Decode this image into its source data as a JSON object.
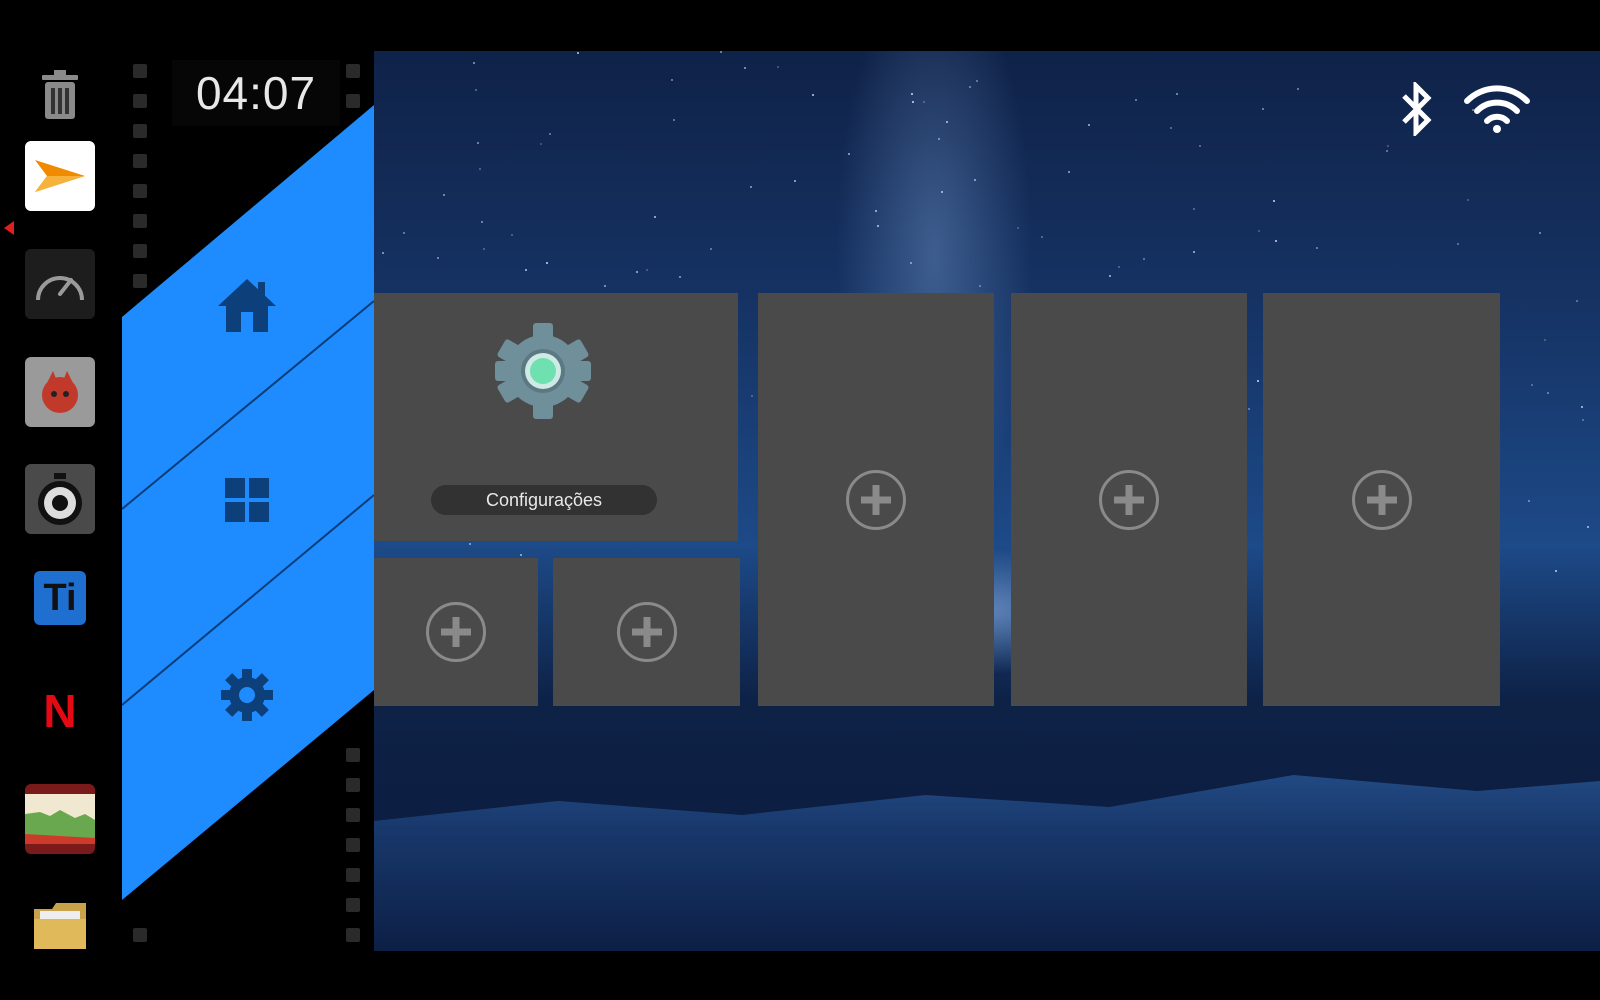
{
  "clock": {
    "time": "04:07"
  },
  "status_bar": {
    "bluetooth_icon": "bluetooth-icon",
    "wifi_icon": "wifi-icon"
  },
  "dock": {
    "apps": [
      {
        "name": "trash-icon"
      },
      {
        "name": "app-3dmark-icon",
        "selected": true
      },
      {
        "name": "speedometer-icon"
      },
      {
        "name": "antutu-icon"
      },
      {
        "name": "stopwatch-icon"
      },
      {
        "name": "titanium-backup-icon"
      },
      {
        "name": "netflix-icon",
        "letter": "N"
      },
      {
        "name": "chart-app-icon"
      },
      {
        "name": "file-manager-icon"
      }
    ]
  },
  "menu": {
    "items": [
      {
        "name": "home-icon"
      },
      {
        "name": "windows-icon"
      },
      {
        "name": "settings-icon"
      }
    ],
    "color": "#1e8cff"
  },
  "tiles": {
    "main": {
      "label": "Configurações",
      "icon": "settings-gear-icon"
    },
    "add_slots": 5
  },
  "dock_text": {
    "ti": "Ti"
  }
}
